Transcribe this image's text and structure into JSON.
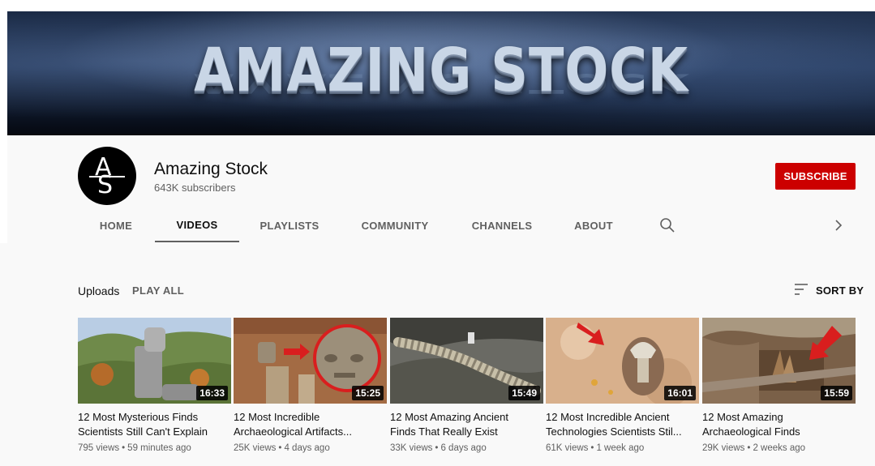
{
  "banner": {
    "title": "AMAZING STOCK"
  },
  "channel": {
    "avatar_letters": [
      "A",
      "S"
    ],
    "name": "Amazing Stock",
    "subscribers": "643K subscribers",
    "subscribe_label": "SUBSCRIBE"
  },
  "tabs": [
    {
      "label": "HOME",
      "active": false
    },
    {
      "label": "VIDEOS",
      "active": true
    },
    {
      "label": "PLAYLISTS",
      "active": false
    },
    {
      "label": "COMMUNITY",
      "active": false
    },
    {
      "label": "CHANNELS",
      "active": false
    },
    {
      "label": "ABOUT",
      "active": false
    }
  ],
  "icons": {
    "search": "search-icon",
    "next": "chevron-right-icon",
    "sort": "sort-icon"
  },
  "uploads": {
    "label": "Uploads",
    "play_all": "PLAY ALL",
    "sort_by": "SORT BY"
  },
  "videos": [
    {
      "title_line1": "12 Most Mysterious Finds",
      "title_line2": "Scientists Still Can't Explain",
      "duration": "16:33",
      "views": "795 views",
      "age": "59 minutes ago"
    },
    {
      "title_line1": "12 Most Incredible",
      "title_line2": "Archaeological Artifacts...",
      "duration": "15:25",
      "views": "25K views",
      "age": "4 days ago"
    },
    {
      "title_line1": "12 Most Amazing Ancient",
      "title_line2": "Finds That Really Exist",
      "duration": "15:49",
      "views": "33K views",
      "age": "6 days ago"
    },
    {
      "title_line1": "12 Most Incredible Ancient",
      "title_line2": "Technologies Scientists Stil...",
      "duration": "16:01",
      "views": "61K views",
      "age": "1 week ago"
    },
    {
      "title_line1": "12 Most Amazing",
      "title_line2": "Archaeological Finds",
      "duration": "15:59",
      "views": "29K views",
      "age": "2 weeks ago"
    }
  ],
  "colors": {
    "subscribe_red": "#cc0000",
    "page_bg": "#f9f9f9",
    "secondary_text": "#606060"
  }
}
